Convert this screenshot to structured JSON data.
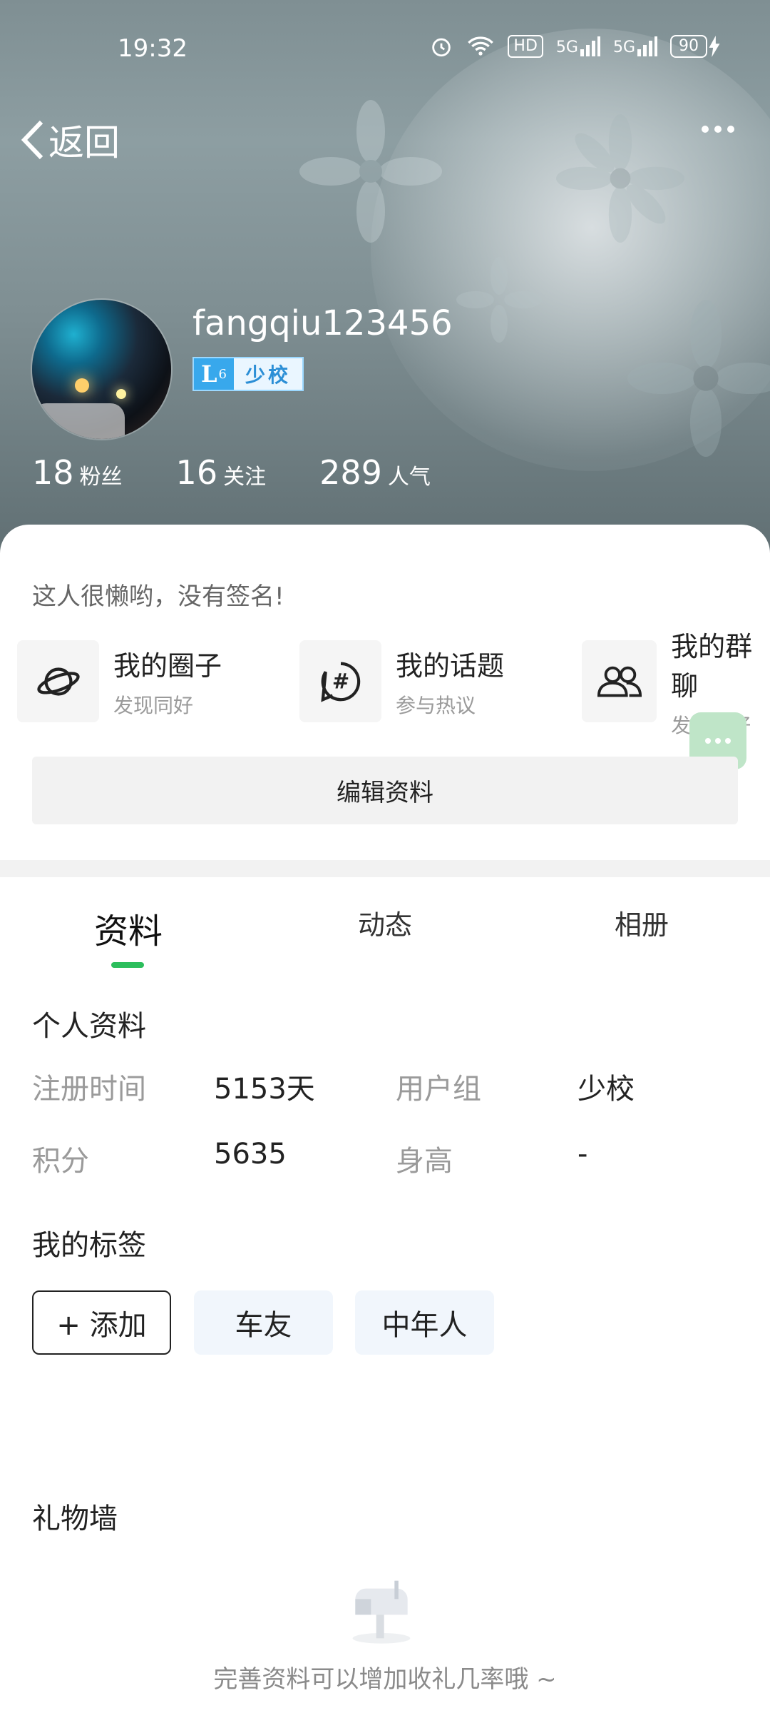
{
  "status_bar": {
    "time": "19:32",
    "hd": "HD",
    "network1": "5G",
    "network2": "5G",
    "battery": "90"
  },
  "header": {
    "back_label": "返回"
  },
  "profile": {
    "username": "fangqiu123456",
    "level": "L",
    "level_num": "6",
    "rank": "少校",
    "stats": [
      {
        "num": "18",
        "label": "粉丝"
      },
      {
        "num": "16",
        "label": "关注"
      },
      {
        "num": "289",
        "label": "人气"
      }
    ],
    "signature": "这人很懒哟，没有签名!"
  },
  "features": [
    {
      "title": "我的圈子",
      "subtitle": "发现同好",
      "icon": "planet-icon"
    },
    {
      "title": "我的话题",
      "subtitle": "参与热议",
      "icon": "hashtag-icon"
    },
    {
      "title": "我的群聊",
      "subtitle": "发现同好",
      "icon": "group-icon"
    }
  ],
  "edit_label": "编辑资料",
  "tabs": [
    {
      "label": "资料",
      "active": true
    },
    {
      "label": "动态",
      "active": false
    },
    {
      "label": "相册",
      "active": false
    }
  ],
  "personal_info": {
    "title": "个人资料",
    "rows": [
      {
        "label1": "注册时间",
        "value1": "5153天",
        "label2": "用户组",
        "value2": "少校"
      },
      {
        "label1": "积分",
        "value1": "5635",
        "label2": "身高",
        "value2": "-"
      }
    ]
  },
  "tags": {
    "title": "我的标签",
    "add_label": "+ 添加",
    "items": [
      "车友",
      "中年人"
    ]
  },
  "gifts": {
    "title": "礼物墙",
    "empty_hint": "完善资料可以增加收礼几率哦 ~"
  },
  "colors": {
    "accent": "#2cbe5c",
    "level_blue": "#38a8ec",
    "float_chat": "#bfe5c8"
  }
}
